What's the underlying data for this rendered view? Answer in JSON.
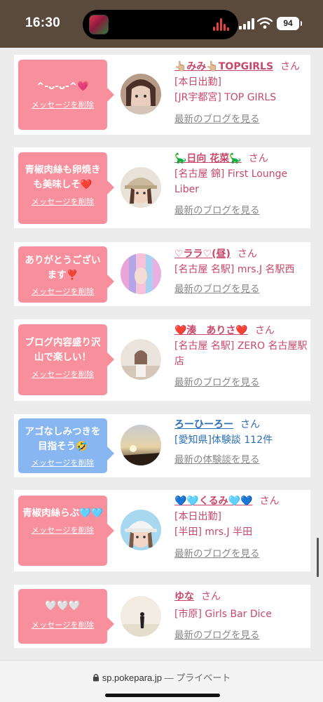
{
  "status_bar": {
    "time": "16:30",
    "battery": "94",
    "colors": {
      "background": "#5a4a3c"
    }
  },
  "delete_label": "メッセージを削除",
  "san": "さん",
  "messages": [
    {
      "bubble": "^-ᴗ-ᴗ-^💗",
      "bubble_color": "pink",
      "name": "👆🏼みみ👆🏼TOPGIRLS",
      "lines": [
        "[本日出勤]",
        "[JR宇都宮] TOP GIRLS"
      ],
      "link": "最新のブログを見る",
      "avatar": "photo-selfie"
    },
    {
      "bubble": "青椒肉絲も卵焼きも美味しそ❤️",
      "bubble_color": "pink",
      "name": "🦕日向 花菜🦕",
      "lines": [
        "[名古屋 錦] First Lounge Liber"
      ],
      "link": "最新のブログを見る",
      "avatar": "photo-cap"
    },
    {
      "bubble": "ありがとうございます❣️",
      "bubble_color": "pink",
      "name": "♡ララ♡(昼)",
      "lines": [
        "[名古屋 名駅] mrs.J 名駅西"
      ],
      "link": "最新のブログを見る",
      "avatar": "photo-rainbow"
    },
    {
      "bubble": "ブログ内容盛り沢山で楽しい！",
      "bubble_color": "pink",
      "name": "❤️湊　ありさ❤️",
      "lines": [
        "[名古屋 名駅] ZERO 名古屋駅店"
      ],
      "link": "最新のブログを見る",
      "avatar": "photo-room"
    },
    {
      "bubble": "アゴなしみつきを目指そう🤣",
      "bubble_color": "blue",
      "name": "ろーひーろー",
      "lines": [
        "[愛知県]体験談 112件"
      ],
      "link": "最新の体験談を見る",
      "avatar": "photo-sunset"
    },
    {
      "bubble": "青椒肉絲らぶ🩵🩵",
      "bubble_color": "pink",
      "name": "💙🩵くるみ🩵💙",
      "lines": [
        "[本日出勤]",
        "[半田] mrs.J 半田"
      ],
      "link": "最新のブログを見る",
      "avatar": "photo-hat"
    },
    {
      "bubble": "🤍🤍🤍",
      "bubble_color": "pink",
      "name": "ゆな",
      "lines": [
        "[市原] Girls Bar Dice"
      ],
      "link": "最新のブログを見る",
      "avatar": "photo-silhouette"
    }
  ],
  "url_bar": {
    "domain": "sp.pokepara.jp",
    "separator": "—",
    "mode": "プライベート"
  },
  "colors": {
    "pink_bubble": "#f7909c",
    "blue_bubble": "#88b6f0",
    "name_pink": "#c8486b",
    "name_blue": "#2d6fb6",
    "link_gray": "#888888"
  }
}
